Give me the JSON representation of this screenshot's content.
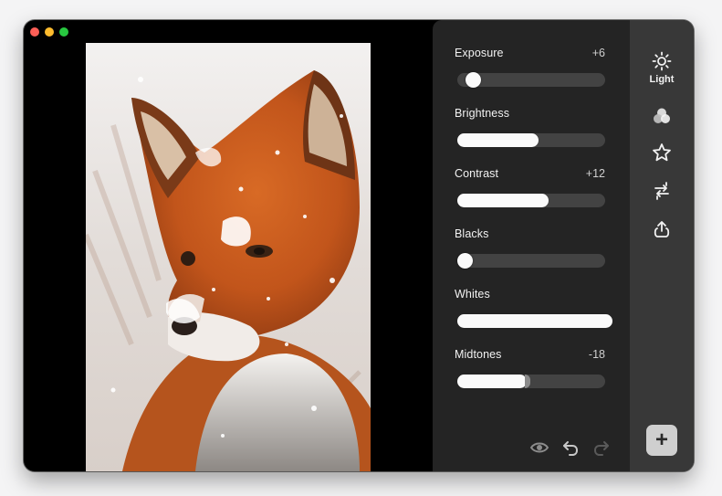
{
  "window": {
    "traffic_lights": [
      "close",
      "minimize",
      "zoom"
    ]
  },
  "photo": {
    "subject": "fox-in-snow"
  },
  "adjustments": {
    "items": [
      {
        "label": "Exposure",
        "value": "+6",
        "level": 0.06,
        "style": "thumb"
      },
      {
        "label": "Brightness",
        "value": "",
        "level": 0.55,
        "style": "fill"
      },
      {
        "label": "Contrast",
        "value": "+12",
        "level": 0.62,
        "style": "fill"
      },
      {
        "label": "Blacks",
        "value": "",
        "level": 0.0,
        "style": "thumb"
      },
      {
        "label": "Whites",
        "value": "",
        "level": 1.0,
        "style": "fill"
      },
      {
        "label": "Midtones",
        "value": "-18",
        "level": 0.47,
        "style": "fill"
      }
    ]
  },
  "toolbar": {
    "icons": [
      "eye-icon",
      "undo-icon",
      "redo-icon"
    ]
  },
  "sidebar": {
    "items": [
      {
        "icon": "sun-icon",
        "label": "Light"
      },
      {
        "icon": "color-circles-icon",
        "label": ""
      },
      {
        "icon": "star-icon",
        "label": ""
      },
      {
        "icon": "crop-rotate-icon",
        "label": ""
      },
      {
        "icon": "export-icon",
        "label": ""
      }
    ],
    "add_label": "+"
  },
  "colors": {
    "panel_bg": "#242424",
    "sidebar_bg": "#383838",
    "track": "#434343",
    "fill": "#fafafa",
    "close": "#fe5f57",
    "minimize": "#febc2e",
    "zoom": "#28c840"
  }
}
